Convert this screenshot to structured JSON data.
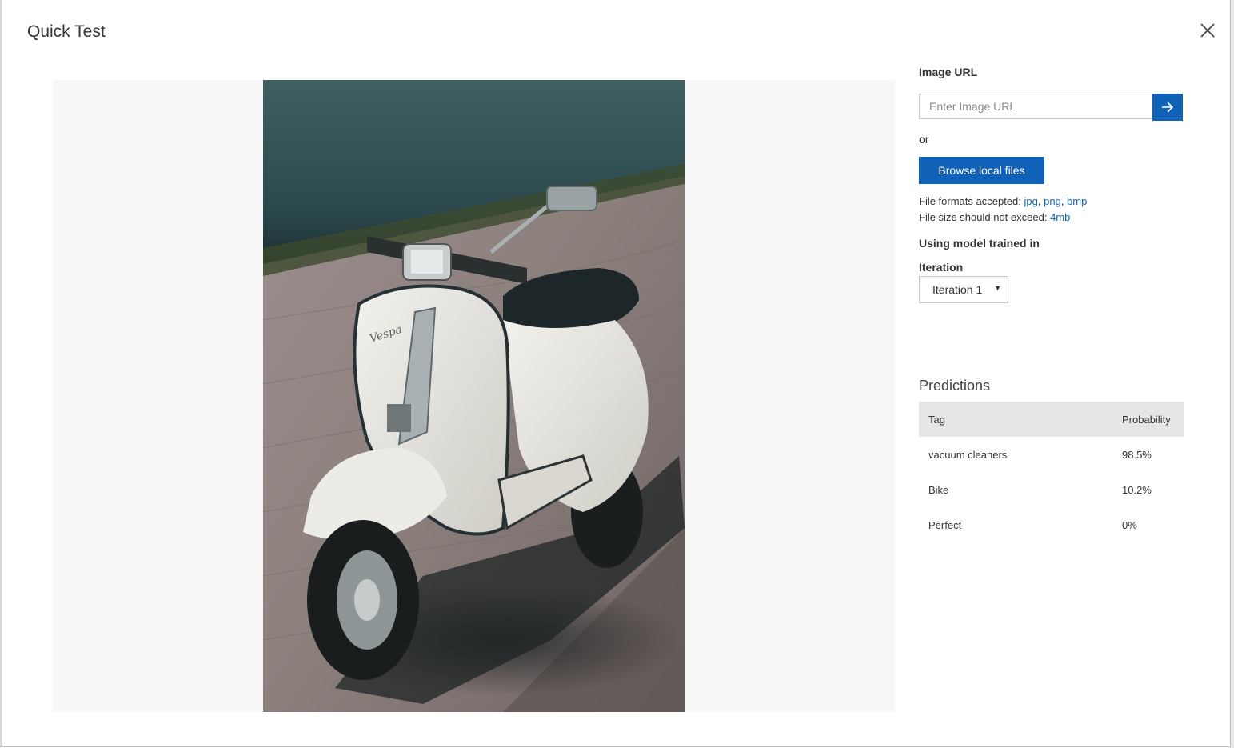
{
  "dialog": {
    "title": "Quick Test"
  },
  "image_url": {
    "label": "Image URL",
    "placeholder": "Enter Image URL"
  },
  "or_text": "or",
  "browse_label": "Browse local files",
  "file_info": {
    "formats_label": "File formats accepted:",
    "formats": [
      "jpg",
      "png",
      "bmp"
    ],
    "size_label": "File size should not exceed:",
    "size_limit": "4mb"
  },
  "model": {
    "using_label": "Using model trained in",
    "iteration_label": "Iteration",
    "iteration_value": "Iteration 1"
  },
  "predictions": {
    "title": "Predictions",
    "columns": [
      "Tag",
      "Probability"
    ],
    "rows": [
      {
        "tag": "vacuum cleaners",
        "probability": "98.5%"
      },
      {
        "tag": "Bike",
        "probability": "10.2%"
      },
      {
        "tag": "Perfect",
        "probability": "0%"
      }
    ]
  },
  "colors": {
    "accent": "#0f62b8",
    "link": "#1566b5"
  },
  "icons": {
    "close": "close-icon",
    "submit": "arrow-right-icon",
    "dropdown": "caret-down-icon"
  },
  "preview_image": "photo of a white vintage scooter parked on a cobblestone pavement"
}
